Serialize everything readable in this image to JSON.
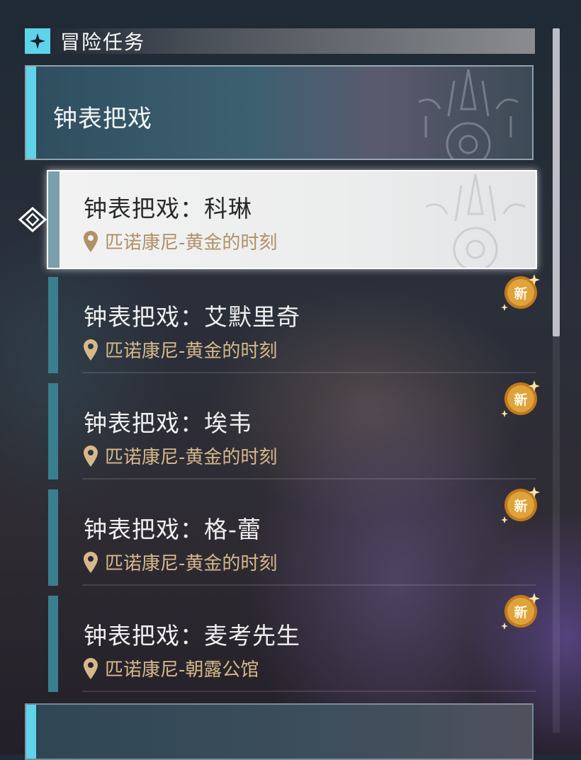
{
  "header": {
    "title": "冒险任务",
    "icon": "sparkle-icon"
  },
  "category": {
    "title": "钟表把戏"
  },
  "quests": [
    {
      "name": "钟表把戏：科琳",
      "location": "匹诺康尼-黄金的时刻",
      "is_new": false,
      "selected": true
    },
    {
      "name": "钟表把戏：艾默里奇",
      "location": "匹诺康尼-黄金的时刻",
      "is_new": true,
      "selected": false
    },
    {
      "name": "钟表把戏：埃韦",
      "location": "匹诺康尼-黄金的时刻",
      "is_new": true,
      "selected": false
    },
    {
      "name": "钟表把戏：格-蕾",
      "location": "匹诺康尼-黄金的时刻",
      "is_new": true,
      "selected": false
    },
    {
      "name": "钟表把戏：麦考先生",
      "location": "匹诺康尼-朝露公馆",
      "is_new": true,
      "selected": false
    }
  ],
  "badge_label": "新",
  "colors": {
    "accent": "#5fd3ea",
    "location_text": "#d6b98a",
    "badge": "#e0a23a"
  }
}
